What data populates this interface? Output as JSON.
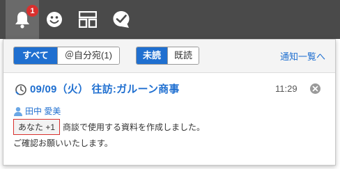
{
  "header": {
    "notification_count": "1",
    "icons": [
      "bell-icon",
      "smiley-icon",
      "apps-grid-icon",
      "check-bubble-icon"
    ]
  },
  "panel": {
    "filter_tabs": [
      {
        "label": "すべて",
        "active": true
      },
      {
        "label": "＠自分宛(1)",
        "active": false
      }
    ],
    "read_tabs": [
      {
        "label": "未読",
        "active": true
      },
      {
        "label": "既読",
        "active": false
      }
    ],
    "view_all_link": "通知一覧へ"
  },
  "notification": {
    "title": "09/09（火） 往訪:ガルーン商事",
    "time": "11:29",
    "sender": "田中 愛美",
    "mention_tag": "あなた +1",
    "body_line1": "商談で使用する資料を作成しました。",
    "body_line2": "ご確認お願いいたします。"
  },
  "colors": {
    "accent": "#1f6fd0",
    "badge": "#d9302e",
    "header_bg": "#4a4a4a"
  }
}
